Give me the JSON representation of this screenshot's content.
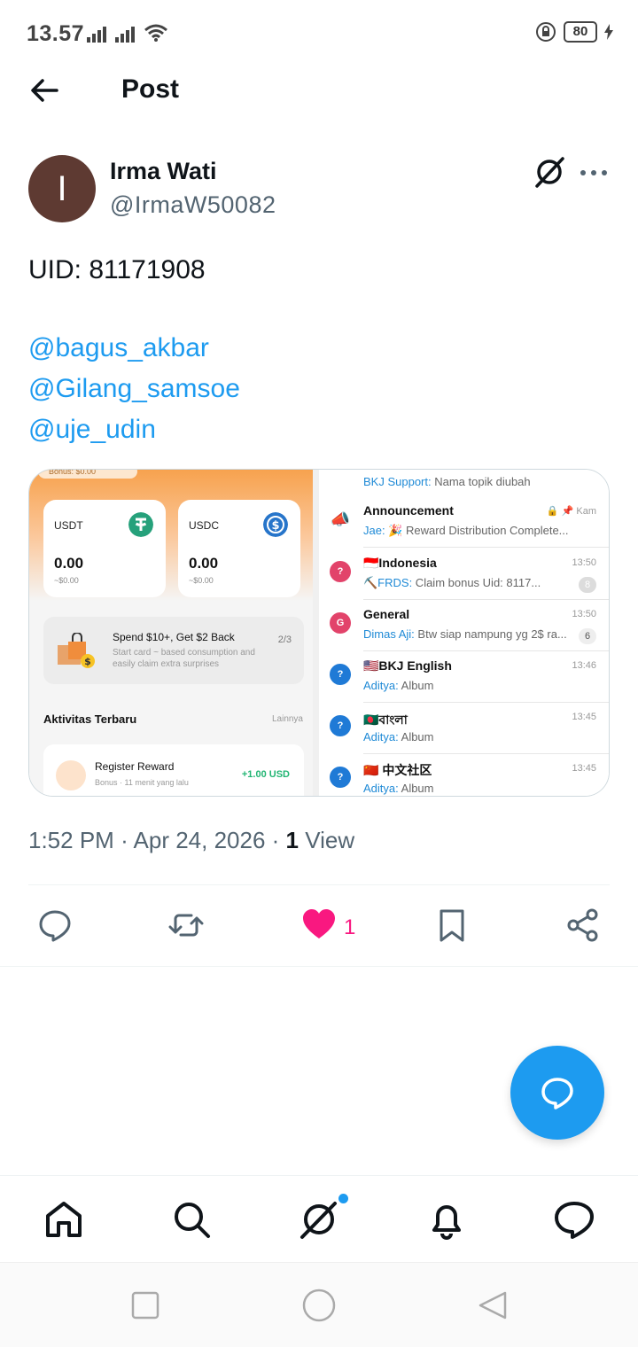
{
  "status_bar": {
    "time": "13.57",
    "battery": "80"
  },
  "header": {
    "title": "Post"
  },
  "author": {
    "avatar_letter": "I",
    "name": "Irma Wati",
    "handle": "@IrmaW50082"
  },
  "post": {
    "text": "UID: 81171908",
    "mentions": [
      "@bagus_akbar",
      "@Gilang_samsoe",
      "@uje_udin"
    ]
  },
  "media": {
    "wallet": {
      "bonus_label": "Bonus: $0.00",
      "coins": [
        {
          "name": "USDT",
          "amount": "0.00",
          "usd": "~$0.00"
        },
        {
          "name": "USDC",
          "amount": "0.00",
          "usd": "~$0.00"
        }
      ],
      "promo_title": "Spend $10+, Get $2 Back",
      "promo_sub": "Start card ~ based consumption and easily claim extra surprises",
      "promo_page": "2/3",
      "activity_title": "Aktivitas Terbaru",
      "activity_more": "Lainnya",
      "reward_title": "Register Reward",
      "reward_sub": "Bonus · 11 menit yang lalu",
      "reward_amount": "+1.00 USD"
    },
    "chats": {
      "top_sender": "BKJ Support:",
      "top_body": "Nama topik diubah",
      "items": [
        {
          "name": "Announcement",
          "sender": "Jae:",
          "body": " 🎉 Reward Distribution Complete...",
          "time": "🔒 📌 Kam",
          "badge": "",
          "avatar_color": "#ffffff",
          "avatar_text": "📣"
        },
        {
          "name": "🇮🇩Indonesia",
          "sender": "⛏️FRDS:",
          "body": " Claim bonus Uid: 8117...",
          "time": "13:50",
          "badge": "8",
          "avatar_color": "#e2436a",
          "avatar_text": "?"
        },
        {
          "name": "General",
          "sender": "Dimas Aji:",
          "body": " Btw siap nampung yg 2$ ra...",
          "time": "13:50",
          "badge": "6",
          "avatar_color": "#e2436a",
          "avatar_text": "G"
        },
        {
          "name": "🇺🇸BKJ English",
          "sender": "Aditya:",
          "body": " Album",
          "time": "13:46",
          "badge": "",
          "avatar_color": "#1f7ad6",
          "avatar_text": "?"
        },
        {
          "name": "🇧🇩বাংলা",
          "sender": "Aditya:",
          "body": " Album",
          "time": "13:45",
          "badge": "",
          "avatar_color": "#1f7ad6",
          "avatar_text": "?"
        },
        {
          "name": "🇨🇳 中文社区",
          "sender": "Aditya:",
          "body": " Album",
          "time": "13:45",
          "badge": "",
          "avatar_color": "#1f7ad6",
          "avatar_text": "?"
        }
      ]
    }
  },
  "meta": {
    "time": "1:52 PM",
    "date": "Apr 24, 2026",
    "views_count": "1",
    "views_label": "View"
  },
  "actions": {
    "like_count": "1",
    "like_color": "#f91880"
  },
  "colors": {
    "accent": "#1d9bf0",
    "like": "#f91880"
  }
}
